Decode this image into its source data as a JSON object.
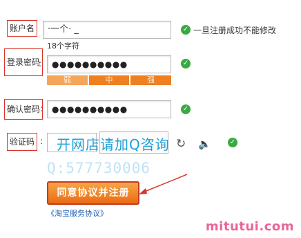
{
  "fields": {
    "account": {
      "label": "账户名",
      "value": "·一个·   _",
      "hint": "18个字符",
      "status_text": "一旦注册成功不能修改"
    },
    "password": {
      "label": "登录密码",
      "value": "●●●●●●●●●●"
    },
    "strength": {
      "weak": "弱",
      "medium": "中",
      "strong": "强",
      "level": 1.0
    },
    "confirm": {
      "label": "确认密码",
      "value": "●●●●●●●●●●"
    },
    "captcha": {
      "label": "验证码",
      "value": ""
    },
    "colon": ":"
  },
  "overlay": {
    "ad_text": "开网店请加Q咨询",
    "qq_text": "Q:577730006"
  },
  "actions": {
    "submit_label": "同意协议并注册",
    "agreement_link": "《淘宝服务协议》"
  },
  "watermark": "mitutui.com",
  "colors": {
    "accent": "#ea6b14",
    "ok": "#3ba844",
    "annotation": "#d9342b",
    "link": "#1a5fb4"
  },
  "icons": {
    "ok": "check-circle-icon",
    "refresh": "refresh-icon",
    "audio": "speaker-icon",
    "arrow": "annotation-arrow"
  }
}
